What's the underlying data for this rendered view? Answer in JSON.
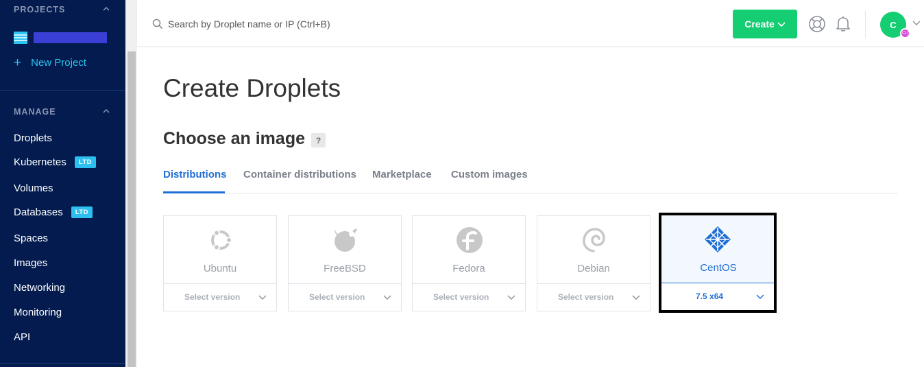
{
  "sidebar": {
    "projects_title": "PROJECTS",
    "new_project_label": "New Project",
    "manage_title": "MANAGE",
    "items": [
      {
        "label": "Droplets",
        "badge": ""
      },
      {
        "label": "Kubernetes",
        "badge": "LTD"
      },
      {
        "label": "Volumes",
        "badge": ""
      },
      {
        "label": "Databases",
        "badge": "LTD"
      },
      {
        "label": "Spaces",
        "badge": ""
      },
      {
        "label": "Images",
        "badge": ""
      },
      {
        "label": "Networking",
        "badge": ""
      },
      {
        "label": "Monitoring",
        "badge": ""
      },
      {
        "label": "API",
        "badge": ""
      }
    ]
  },
  "topbar": {
    "search_placeholder": "Search by Droplet name or IP (Ctrl+B)",
    "create_label": "Create",
    "avatar_initial": "C",
    "avatar_badge": "CU"
  },
  "main": {
    "page_title": "Create Droplets",
    "section_title": "Choose an image",
    "help_label": "?",
    "tabs": [
      {
        "label": "Distributions",
        "active": true
      },
      {
        "label": "Container distributions",
        "active": false
      },
      {
        "label": "Marketplace",
        "active": false
      },
      {
        "label": "Custom images",
        "active": false
      }
    ],
    "images": [
      {
        "name": "Ubuntu",
        "version": "Select version",
        "icon": "ubuntu-icon",
        "selected": false
      },
      {
        "name": "FreeBSD",
        "version": "Select version",
        "icon": "freebsd-icon",
        "selected": false
      },
      {
        "name": "Fedora",
        "version": "Select version",
        "icon": "fedora-icon",
        "selected": false
      },
      {
        "name": "Debian",
        "version": "Select version",
        "icon": "debian-icon",
        "selected": false
      },
      {
        "name": "CentOS",
        "version": "7.5 x64",
        "icon": "centos-icon",
        "selected": true
      }
    ]
  },
  "colors": {
    "sidebar_bg": "#031b4e",
    "accent_blue": "#1e6ed6",
    "create_green": "#15cd72",
    "badge_blue": "#2cbff0"
  }
}
